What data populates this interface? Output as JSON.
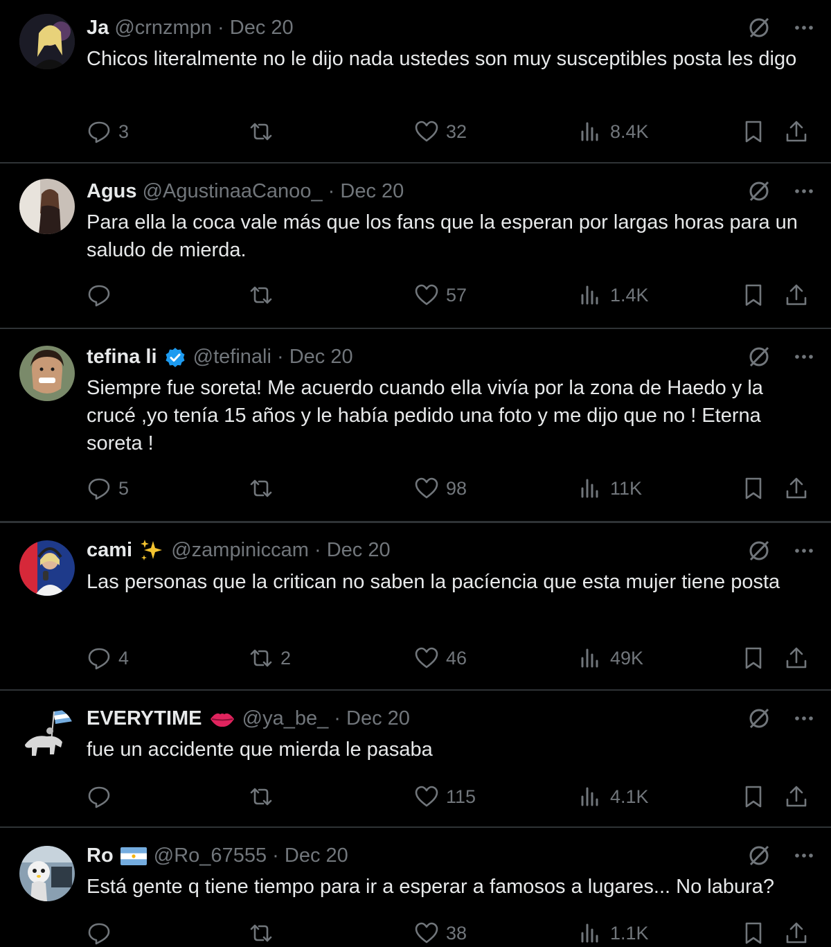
{
  "tweets": [
    {
      "name": "Ja",
      "handle": "@crnzmpn",
      "sep": "·",
      "date": "Dec 20",
      "verified": false,
      "badge": "",
      "text": "Chicos literalmente no le dijo nada ustedes son muy susceptibles posta les digo",
      "replies": "3",
      "retweets": "",
      "likes": "32",
      "views": "8.4K",
      "avatar": "avatar-blonde-woman"
    },
    {
      "name": "Agus",
      "handle": "@AgustinaaCanoo_",
      "sep": "·",
      "date": "Dec 20",
      "verified": false,
      "badge": "",
      "text": "Para ella la coca vale más que los fans que la esperan por largas horas para un saludo de mierda.",
      "replies": "",
      "retweets": "",
      "likes": "57",
      "views": "1.4K",
      "avatar": "avatar-woman-mirror"
    },
    {
      "name": "tefina li",
      "handle": "@tefinali",
      "sep": "·",
      "date": "Dec 20",
      "verified": true,
      "badge": "",
      "text": "Siempre fue soreta! Me acuerdo cuando ella vivía por la zona de Haedo y la crucé ,yo tenía 15 años y le había pedido una foto y me dijo que no ! Eterna soreta !",
      "replies": "5",
      "retweets": "",
      "likes": "98",
      "views": "11K",
      "avatar": "avatar-smiling-man"
    },
    {
      "name": "cami",
      "handle": "@zampiniccam",
      "sep": "·",
      "date": "Dec 20",
      "verified": false,
      "badge": "sparkles",
      "text": "Las personas que la critican no saben la pacíencia que esta mujer tiene posta",
      "replies": "4",
      "retweets": "2",
      "likes": "46",
      "views": "49K",
      "avatar": "avatar-radio-host"
    },
    {
      "name": "EVERYTIME",
      "handle": "@ya_be_",
      "sep": "·",
      "date": "Dec 20",
      "verified": false,
      "badge": "lips",
      "text": "fue un accidente que mierda le pasaba",
      "replies": "",
      "retweets": "",
      "likes": "115",
      "views": "4.1K",
      "avatar": "avatar-horse-flag"
    },
    {
      "name": "Ro",
      "handle": "@Ro_67555",
      "sep": "·",
      "date": "Dec 20",
      "verified": false,
      "badge": "argentina-flag",
      "text": "Está gente q tiene tiempo para ir a esperar a famosos a lugares... No labura?",
      "replies": "",
      "retweets": "",
      "likes": "38",
      "views": "1.1K",
      "avatar": "avatar-mascot"
    }
  ],
  "colors": {
    "background": "#000000",
    "text": "#e7e9ea",
    "muted": "#71767b",
    "divider": "#2f3336",
    "verified": "#1d9bf0"
  },
  "icons": [
    "reply-icon",
    "retweet-icon",
    "like-icon",
    "views-icon",
    "bookmark-icon",
    "share-icon",
    "grok-icon",
    "more-icon",
    "verified-icon"
  ]
}
